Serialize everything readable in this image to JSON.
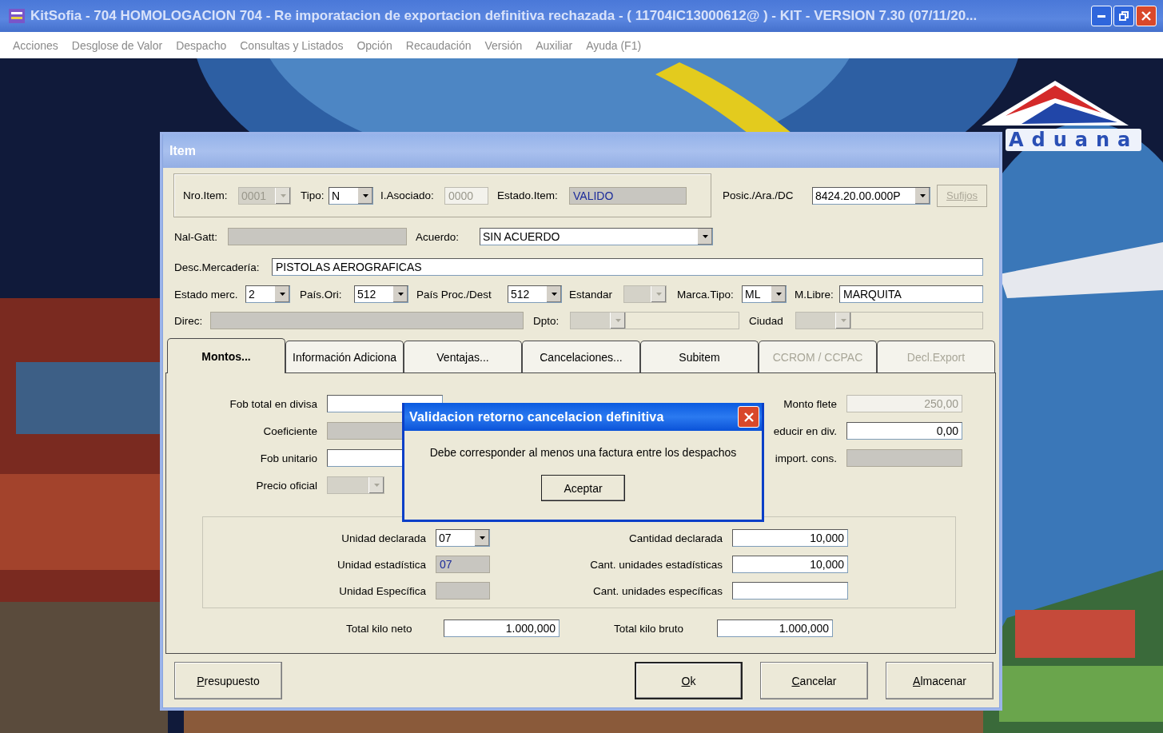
{
  "window": {
    "title": "KitSofia - 704 HOMOLOGACION 704 - Re imporatacion de exportacion definitiva rechazada - ( 11704IC13000612@ ) - KIT - VERSION 7.30 (07/11/20..."
  },
  "menu": [
    {
      "label": "Acciones"
    },
    {
      "label": "Desglose de Valor"
    },
    {
      "label": "Despacho"
    },
    {
      "label": "Consultas y Listados"
    },
    {
      "label": "Opción"
    },
    {
      "label": "Recaudación"
    },
    {
      "label": "Versión"
    },
    {
      "label": "Auxiliar"
    },
    {
      "label": "Ayuda (F1)"
    }
  ],
  "logo": {
    "text": "Aduana"
  },
  "item": {
    "title": "Item",
    "header_group": [
      {
        "label": "Nro.Item:",
        "value": "0001",
        "kind": "combo",
        "disabled": true
      },
      {
        "label": "Tipo:",
        "value": "N",
        "kind": "combo",
        "disabled": false
      },
      {
        "label": "I.Asociado:",
        "value": "0000",
        "kind": "text",
        "disabled": true
      },
      {
        "label": "Estado.Item:",
        "value": "VALIDO",
        "kind": "readonly",
        "disabled": false
      }
    ],
    "posicion": {
      "label": "Posic./Ara./DC",
      "value": "8424.20.00.000P",
      "kind": "combo",
      "disabled": false
    },
    "sufijos": {
      "label": "Sufijos",
      "disabled": true
    },
    "rows": [
      [
        {
          "label": "Nal-Gatt:",
          "kind": "readonly",
          "disabled": false
        },
        {
          "label": "Acuerdo:",
          "value": "SIN ACUERDO",
          "kind": "combo",
          "disabled": false
        }
      ],
      [
        {
          "label": "Desc.Mercadería:",
          "value": "PISTOLAS AEROGRAFICAS",
          "kind": "text",
          "disabled": false
        }
      ],
      [
        {
          "label": "Estado merc.",
          "value": "2",
          "kind": "combo",
          "disabled": false
        },
        {
          "label": "País.Ori:",
          "value": "512",
          "kind": "combo",
          "disabled": false
        },
        {
          "label": "País Proc./Dest",
          "value": "512",
          "kind": "combo",
          "disabled": false
        },
        {
          "label": "Estandar",
          "kind": "combo",
          "disabled": true
        },
        {
          "label": "Marca.Tipo:",
          "value": "ML",
          "kind": "combo",
          "disabled": false
        },
        {
          "label": "M.Libre:",
          "value": "MARQUITA",
          "kind": "text",
          "disabled": false
        }
      ],
      [
        {
          "label": "Direc:",
          "kind": "readonly",
          "disabled": false
        },
        {
          "label": "Dpto:",
          "kind": "combo_ext",
          "disabled": true
        },
        {
          "label": "Ciudad",
          "kind": "combo_ext",
          "disabled": true
        }
      ]
    ],
    "tabs": [
      {
        "label": "Montos...",
        "selected": true,
        "disabled": false
      },
      {
        "label": "Información Adiciona",
        "selected": false,
        "disabled": false
      },
      {
        "label": "Ventajas...",
        "selected": false,
        "disabled": false
      },
      {
        "label": "Cancelaciones...",
        "selected": false,
        "disabled": false
      },
      {
        "label": "Subitem",
        "selected": false,
        "disabled": false
      },
      {
        "label": "CCROM / CCPAC",
        "selected": false,
        "disabled": true
      },
      {
        "label": "Decl.Export",
        "selected": false,
        "disabled": true
      }
    ],
    "montos": {
      "left": [
        {
          "label": "Fob total en divisa",
          "kind": "number",
          "disabled": false
        },
        {
          "label": "Coeficiente",
          "kind": "readonly",
          "disabled": false
        },
        {
          "label": "Fob unitario",
          "kind": "number",
          "disabled": false
        },
        {
          "label": "Precio oficial",
          "kind": "combo",
          "disabled": true
        }
      ],
      "right": [
        {
          "label": "Monto flete",
          "value": "250,00",
          "kind": "number",
          "disabled": true
        },
        {
          "label": "educir en div.",
          "value": "0,00",
          "kind": "number",
          "disabled": false
        },
        {
          "label": "import. cons.",
          "kind": "readonly",
          "disabled": false
        }
      ]
    },
    "units": {
      "left": [
        {
          "label": "Unidad declarada",
          "value": "07",
          "kind": "combo",
          "disabled": false
        },
        {
          "label": "Unidad estadística",
          "value": "07",
          "kind": "readonly",
          "disabled": false
        },
        {
          "label": "Unidad Específica",
          "kind": "readonly",
          "disabled": false
        }
      ],
      "right": [
        {
          "label": "Cantidad declarada",
          "value": "10,000",
          "kind": "number",
          "disabled": false
        },
        {
          "label": "Cant. unidades estadísticas",
          "value": "10,000",
          "kind": "number",
          "disabled": false
        },
        {
          "label": "Cant. unidades específicas",
          "kind": "number",
          "disabled": false
        }
      ]
    },
    "totals": [
      {
        "label": "Total kilo neto",
        "value": "1.000,000",
        "kind": "number",
        "disabled": false
      },
      {
        "label": "Total kilo bruto",
        "value": "1.000,000",
        "kind": "number",
        "disabled": false
      }
    ],
    "buttons": [
      {
        "label": "Presupuesto",
        "default": false
      },
      {
        "label": "Ok",
        "default": true
      },
      {
        "label": "Cancelar",
        "default": false
      },
      {
        "label": "Almacenar",
        "default": false
      }
    ]
  },
  "alert": {
    "title": "Validacion retorno cancelacion definitiva",
    "message": "Debe corresponder al menos una factura entre los despachos",
    "button": "Aceptar"
  }
}
